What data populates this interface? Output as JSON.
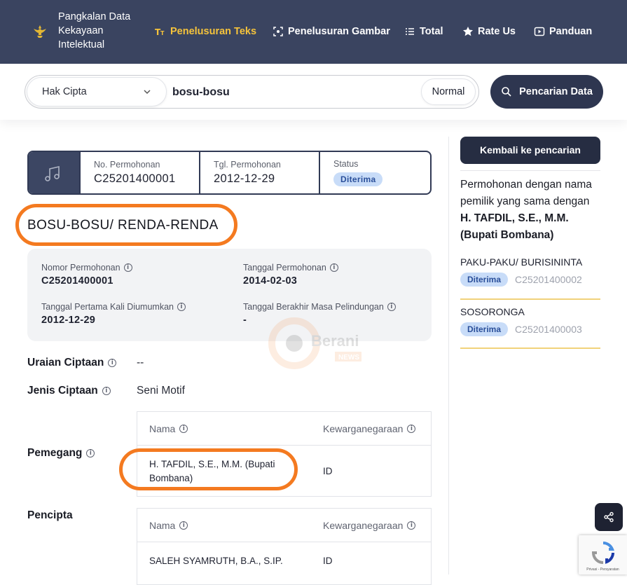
{
  "header": {
    "brand_lines": [
      "Pangkalan Data",
      "Kekayaan",
      "Intelektual"
    ],
    "nav": [
      {
        "label": "Penelusuran Teks",
        "icon": "text-type-icon",
        "active": true
      },
      {
        "label": "Penelusuran Gambar",
        "icon": "image-scan-icon",
        "active": false
      },
      {
        "label": "Total",
        "icon": "list-icon",
        "active": false
      },
      {
        "label": "Rate Us",
        "icon": "star-icon",
        "active": false
      },
      {
        "label": "Panduan",
        "icon": "play-icon",
        "active": false
      }
    ]
  },
  "search": {
    "category": "Hak Cipta",
    "query": "bosu-bosu",
    "mode": "Normal",
    "button": "Pencarian Data"
  },
  "summary": {
    "no_label": "No. Permohonan",
    "no_value": "C25201400001",
    "tgl_label": "Tgl. Permohonan",
    "tgl_value": "2012-12-29",
    "status_label": "Status",
    "status_value": "Diterima"
  },
  "title": "BOSU-BOSU/ RENDA-RENDA",
  "details": {
    "nomor_label": "Nomor Permohonan",
    "nomor_value": "C25201400001",
    "tanggal_label": "Tanggal Permohonan",
    "tanggal_value": "2014-02-03",
    "diumumkan_label": "Tanggal Pertama Kali Diumumkan",
    "diumumkan_value": "2012-12-29",
    "berakhir_label": "Tanggal Berakhir Masa Pelindungan",
    "berakhir_value": "-"
  },
  "uraian": {
    "label": "Uraian Ciptaan",
    "value": "--"
  },
  "jenis": {
    "label": "Jenis Ciptaan",
    "value": "Seni Motif"
  },
  "pemegang": {
    "label": "Pemegang",
    "col_nama": "Nama",
    "col_warga": "Kewarganegaraan",
    "nama": "H. TAFDIL, S.E., M.M. (Bupati Bombana)",
    "warga": "ID"
  },
  "pencipta": {
    "label": "Pencipta",
    "col_nama": "Nama",
    "col_warga": "Kewarganegaraan",
    "nama": "SALEH SYAMRUTH, B.A., S.IP.",
    "warga": "ID"
  },
  "sidebar": {
    "back_label": "Kembali ke pencarian",
    "heading_prefix": "Permohonan dengan nama pemilik yang sama dengan",
    "heading_owner": "H. TAFDIL, S.E., M.M. (Bupati Bombana)",
    "items": [
      {
        "title": "PAKU-PAKU/ BURISININTA",
        "status": "Diterima",
        "number": "C25201400002"
      },
      {
        "title": "SOSORONGA",
        "status": "Diterima",
        "number": "C25201400003"
      }
    ]
  },
  "watermark": {
    "line1": "Berani",
    "line2": "NEWS"
  },
  "recaptcha": {
    "text": "Privasi - Persyaratan"
  },
  "colors": {
    "navy": "#3a4460",
    "accent_gold": "#f5c33b",
    "highlight_ring": "#f47a20",
    "badge_bg": "#c8dcf8"
  }
}
